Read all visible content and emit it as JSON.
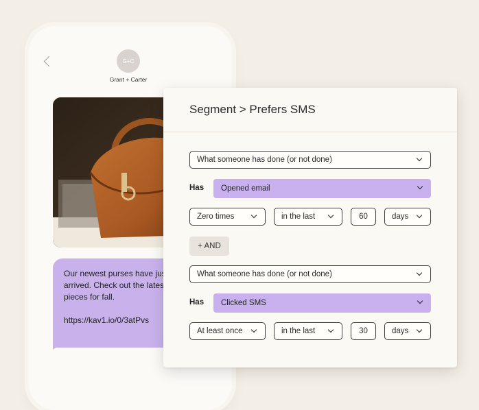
{
  "phone": {
    "avatar_initials": "G+C",
    "contact_name": "Grant + Carter",
    "message_text": "Our newest purses have just\narrived. Check out the latest\npieces for fall.",
    "message_link": "https://kav1.io/0/3atPvs"
  },
  "panel": {
    "title": "Segment > Prefers SMS",
    "has_label": "Has",
    "and_label": "+ AND",
    "conditions": [
      {
        "type": "What someone has done (or not done)",
        "metric": "Opened email",
        "frequency": "Zero times",
        "timeframe": "in the last",
        "number": "60",
        "unit": "days"
      },
      {
        "type": "What someone has done (or not done)",
        "metric": "Clicked SMS",
        "frequency": "At least once",
        "timeframe": "in the last",
        "number": "30",
        "unit": "days"
      }
    ]
  },
  "colors": {
    "background": "#f4efe6",
    "accent_purple": "#c8b1ee",
    "panel_bg": "#fbf9f4"
  }
}
